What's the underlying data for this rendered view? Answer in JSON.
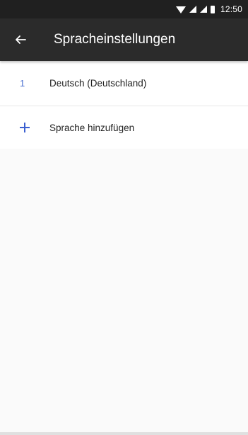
{
  "status_bar": {
    "time": "12:50",
    "icons": [
      "wifi-icon",
      "signal-icon",
      "signal-icon",
      "battery-icon"
    ]
  },
  "toolbar": {
    "back_icon": "arrow-left-icon",
    "title": "Spracheinstellungen"
  },
  "languages": [
    {
      "index": "1",
      "label": "Deutsch (Deutschland)"
    }
  ],
  "add_language": {
    "icon": "plus-icon",
    "label": "Sprache hinzufügen"
  },
  "colors": {
    "toolbar": "#2b2b2b",
    "status_bar": "#202020",
    "accent": "#3b5fd0"
  }
}
